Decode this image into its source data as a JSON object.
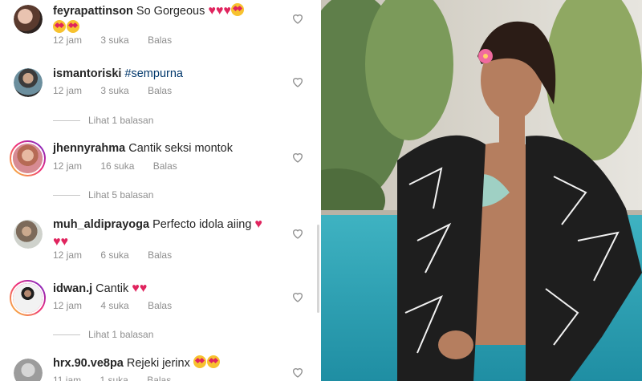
{
  "comments": [
    {
      "username": "feyrapattinson",
      "text": "So Gorgeous",
      "time": "12 jam",
      "likes": "3 suka",
      "reply": "Balas"
    },
    {
      "username": "ismantoriski",
      "text": "#sempurna",
      "time": "12 jam",
      "likes": "3 suka",
      "reply": "Balas",
      "view_replies": "Lihat 1 balasan"
    },
    {
      "username": "jhennyrahma",
      "text": "Cantik seksi montok",
      "time": "12 jam",
      "likes": "16 suka",
      "reply": "Balas",
      "view_replies": "Lihat 5 balasan"
    },
    {
      "username": "muh_aldiprayoga",
      "text": "Perfecto idola aiing",
      "time": "12 jam",
      "likes": "6 suka",
      "reply": "Balas"
    },
    {
      "username": "idwan.j",
      "text": "Cantik",
      "time": "12 jam",
      "likes": "4 suka",
      "reply": "Balas",
      "view_replies": "Lihat 1 balasan"
    },
    {
      "username": "hrx.90.ve8pa",
      "text": "Rejeki jerinx",
      "time": "11 jam",
      "likes": "1 suka",
      "reply": "Balas"
    }
  ],
  "colors": {
    "accent_link": "#00376b",
    "secondary_text": "#8e8e8e",
    "heart": "#e0245e"
  }
}
